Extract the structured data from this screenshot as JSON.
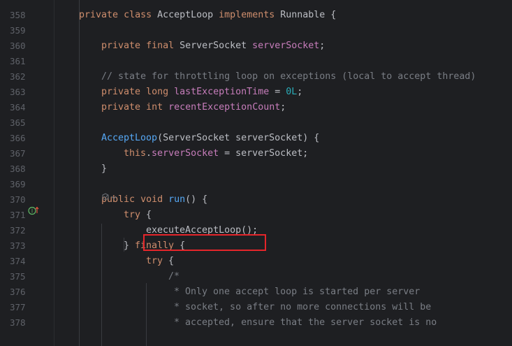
{
  "editor": {
    "theme_colors": {
      "background": "#1e1f22",
      "keyword": "#cf8e6d",
      "field": "#c77dbb",
      "number": "#2aacb8",
      "comment": "#7a7e85",
      "method": "#56a8f5",
      "text": "#bcbec4",
      "line_number": "#5f6269",
      "highlight_box": "#e5252a"
    },
    "gutter_icon": "override-method-icon",
    "inlay_icon": "ai-assist-icon",
    "lines": [
      {
        "number": "358",
        "tokens": [
          [
            "kw",
            "private"
          ],
          [
            "plain",
            " "
          ],
          [
            "kw",
            "class"
          ],
          [
            "plain",
            " AcceptLoop "
          ],
          [
            "kw",
            "implements"
          ],
          [
            "plain",
            " Runnable {"
          ]
        ]
      },
      {
        "number": "359",
        "tokens": []
      },
      {
        "number": "360",
        "tokens": [
          [
            "kw",
            "private"
          ],
          [
            "plain",
            " "
          ],
          [
            "kw",
            "final"
          ],
          [
            "plain",
            " ServerSocket "
          ],
          [
            "field",
            "serverSocket"
          ],
          [
            "plain",
            ";"
          ]
        ]
      },
      {
        "number": "361",
        "tokens": []
      },
      {
        "number": "362",
        "tokens": [
          [
            "cm",
            "// state for throttling loop on exceptions (local to accept thread)"
          ]
        ]
      },
      {
        "number": "363",
        "tokens": [
          [
            "kw",
            "private"
          ],
          [
            "plain",
            " "
          ],
          [
            "kw",
            "long"
          ],
          [
            "plain",
            " "
          ],
          [
            "field",
            "lastExceptionTime"
          ],
          [
            "plain",
            " = "
          ],
          [
            "num",
            "0L"
          ],
          [
            "plain",
            ";"
          ]
        ]
      },
      {
        "number": "364",
        "tokens": [
          [
            "kw",
            "private"
          ],
          [
            "plain",
            " "
          ],
          [
            "kw",
            "int"
          ],
          [
            "plain",
            " "
          ],
          [
            "field",
            "recentExceptionCount"
          ],
          [
            "plain",
            ";"
          ]
        ]
      },
      {
        "number": "365",
        "tokens": []
      },
      {
        "number": "366",
        "tokens": [
          [
            "fn",
            "AcceptLoop"
          ],
          [
            "plain",
            "(ServerSocket serverSocket) {"
          ]
        ]
      },
      {
        "number": "367",
        "tokens": [
          [
            "kw",
            "this"
          ],
          [
            "plain",
            "."
          ],
          [
            "field",
            "serverSocket"
          ],
          [
            "plain",
            " = serverSocket;"
          ]
        ]
      },
      {
        "number": "368",
        "tokens": [
          [
            "plain",
            "}"
          ]
        ]
      },
      {
        "number": "369",
        "tokens": []
      },
      {
        "number": "370",
        "tokens": [
          [
            "kw",
            "public"
          ],
          [
            "plain",
            " "
          ],
          [
            "kw",
            "void"
          ],
          [
            "plain",
            " "
          ],
          [
            "fn",
            "run"
          ],
          [
            "plain",
            "() {"
          ]
        ]
      },
      {
        "number": "371",
        "tokens": [
          [
            "kw",
            "try"
          ],
          [
            "plain",
            " {"
          ]
        ]
      },
      {
        "number": "372",
        "tokens": [
          [
            "plain",
            "executeAcceptLoop();"
          ]
        ]
      },
      {
        "number": "373",
        "tokens": [
          [
            "plain",
            "} "
          ],
          [
            "kw",
            "finally"
          ],
          [
            "plain",
            " {"
          ]
        ]
      },
      {
        "number": "374",
        "tokens": [
          [
            "kw",
            "try"
          ],
          [
            "plain",
            " {"
          ]
        ]
      },
      {
        "number": "375",
        "tokens": [
          [
            "cm",
            "/*"
          ]
        ]
      },
      {
        "number": "376",
        "tokens": [
          [
            "cm",
            " * Only one accept loop is started per server"
          ]
        ]
      },
      {
        "number": "377",
        "tokens": [
          [
            "cm",
            " * socket, so after no more connections will be"
          ]
        ]
      },
      {
        "number": "378",
        "tokens": [
          [
            "cm",
            " * accepted, ensure that the server socket is no"
          ]
        ]
      }
    ]
  }
}
